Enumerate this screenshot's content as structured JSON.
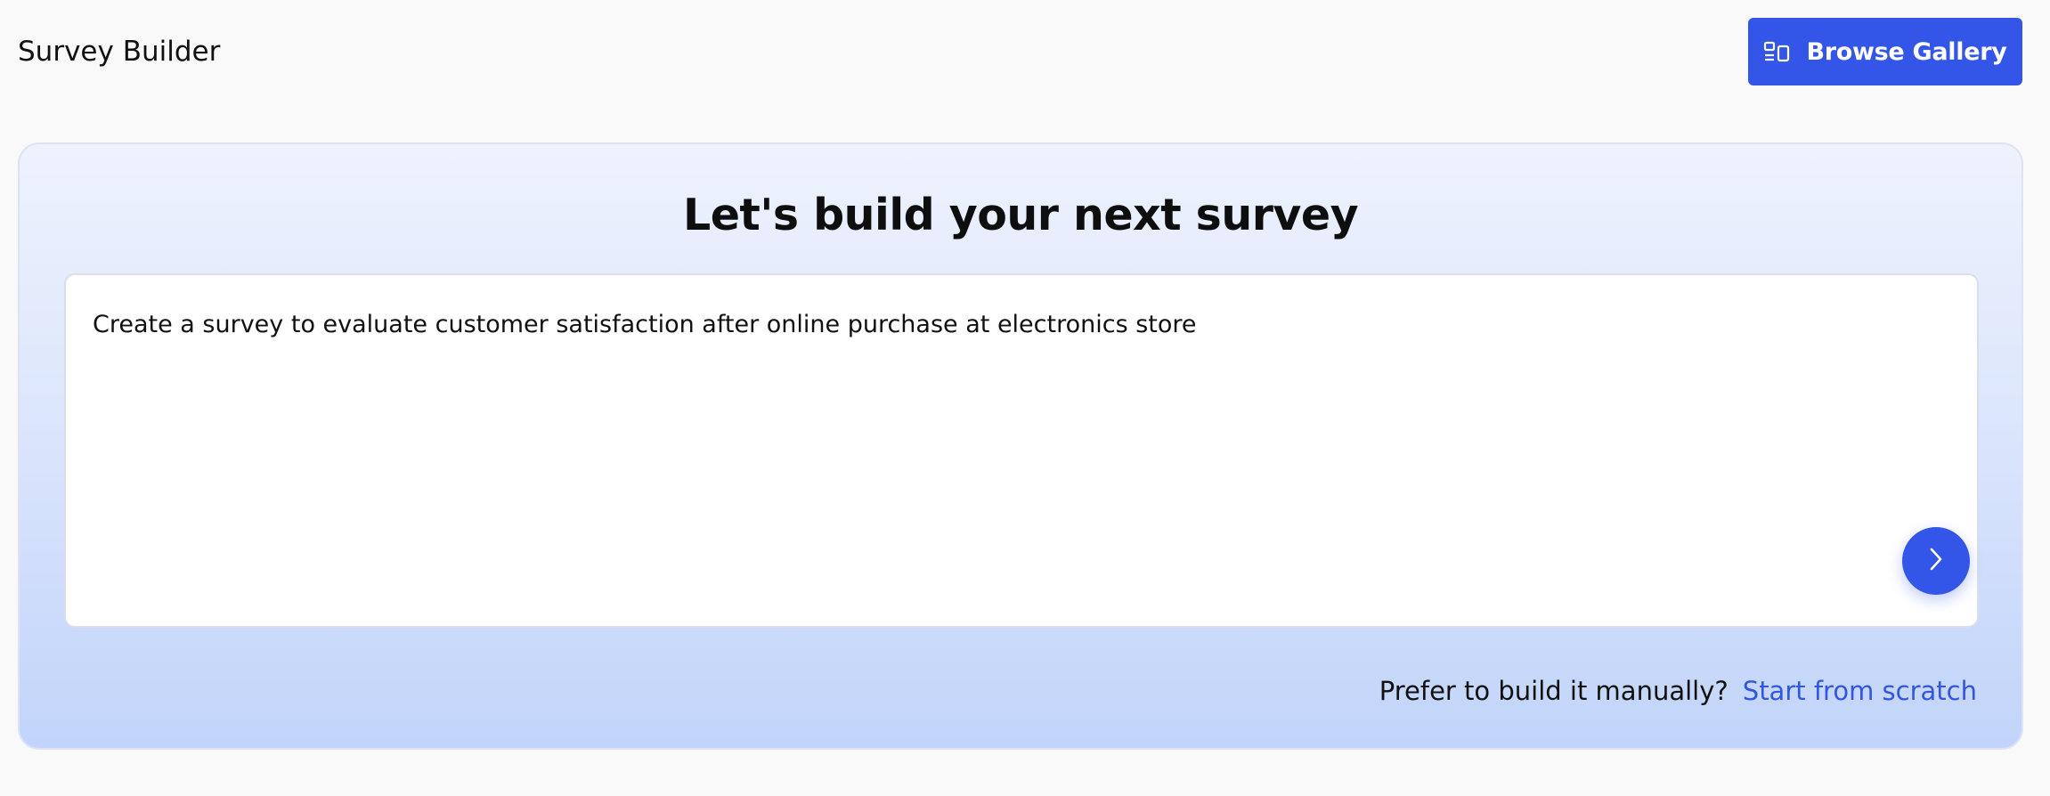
{
  "app": {
    "title": "Survey Builder"
  },
  "header": {
    "gallery_button": {
      "label": "Browse Gallery",
      "icon": "gallery-icon"
    }
  },
  "hero": {
    "heading": "Let's build your next survey",
    "prompt_value": "Create a survey to evaluate customer satisfaction after online purchase at electronics store",
    "submit_icon": "chevron-right-icon",
    "manual_prompt": "Prefer to build it manually?",
    "scratch_link": "Start from scratch"
  },
  "colors": {
    "accent": "#3355e8",
    "link": "#3356e0",
    "page_background": "#f9f9f9",
    "card_gradient_top": "#eef2fd",
    "card_gradient_bottom": "#c1d4fa"
  }
}
